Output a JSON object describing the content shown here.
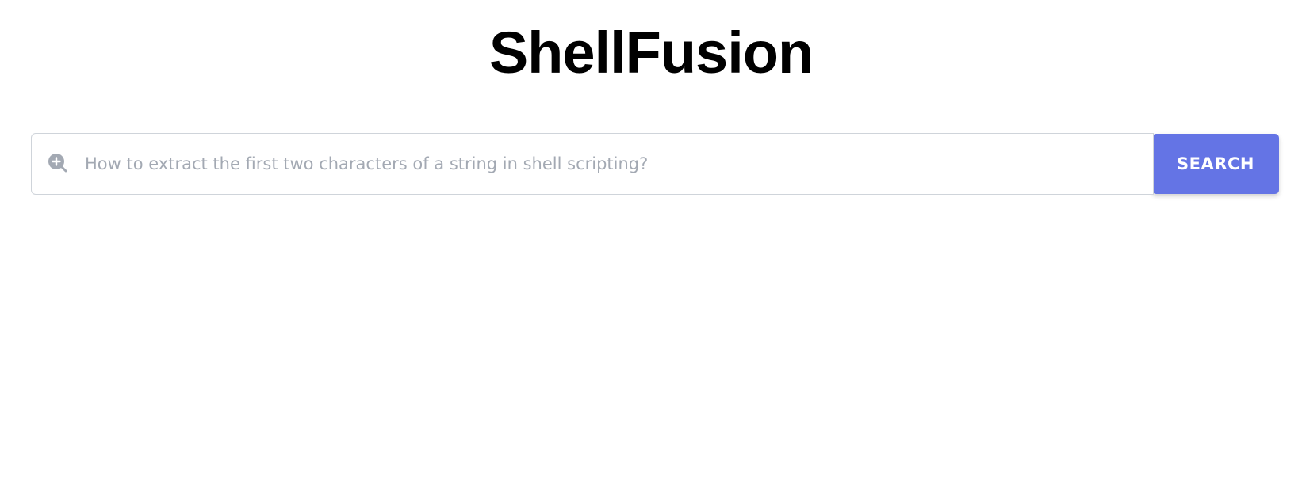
{
  "logo": {
    "text": "ShellFusion"
  },
  "search": {
    "placeholder": "How to extract the first two characters of a string in shell scripting?",
    "value": "",
    "icon": "search-plus-icon",
    "button_label": "SEARCH"
  },
  "colors": {
    "button": "#6474e5",
    "placeholder": "#a3a9b3",
    "input_border": "#cfd4da",
    "icon": "#a3a9b3"
  }
}
